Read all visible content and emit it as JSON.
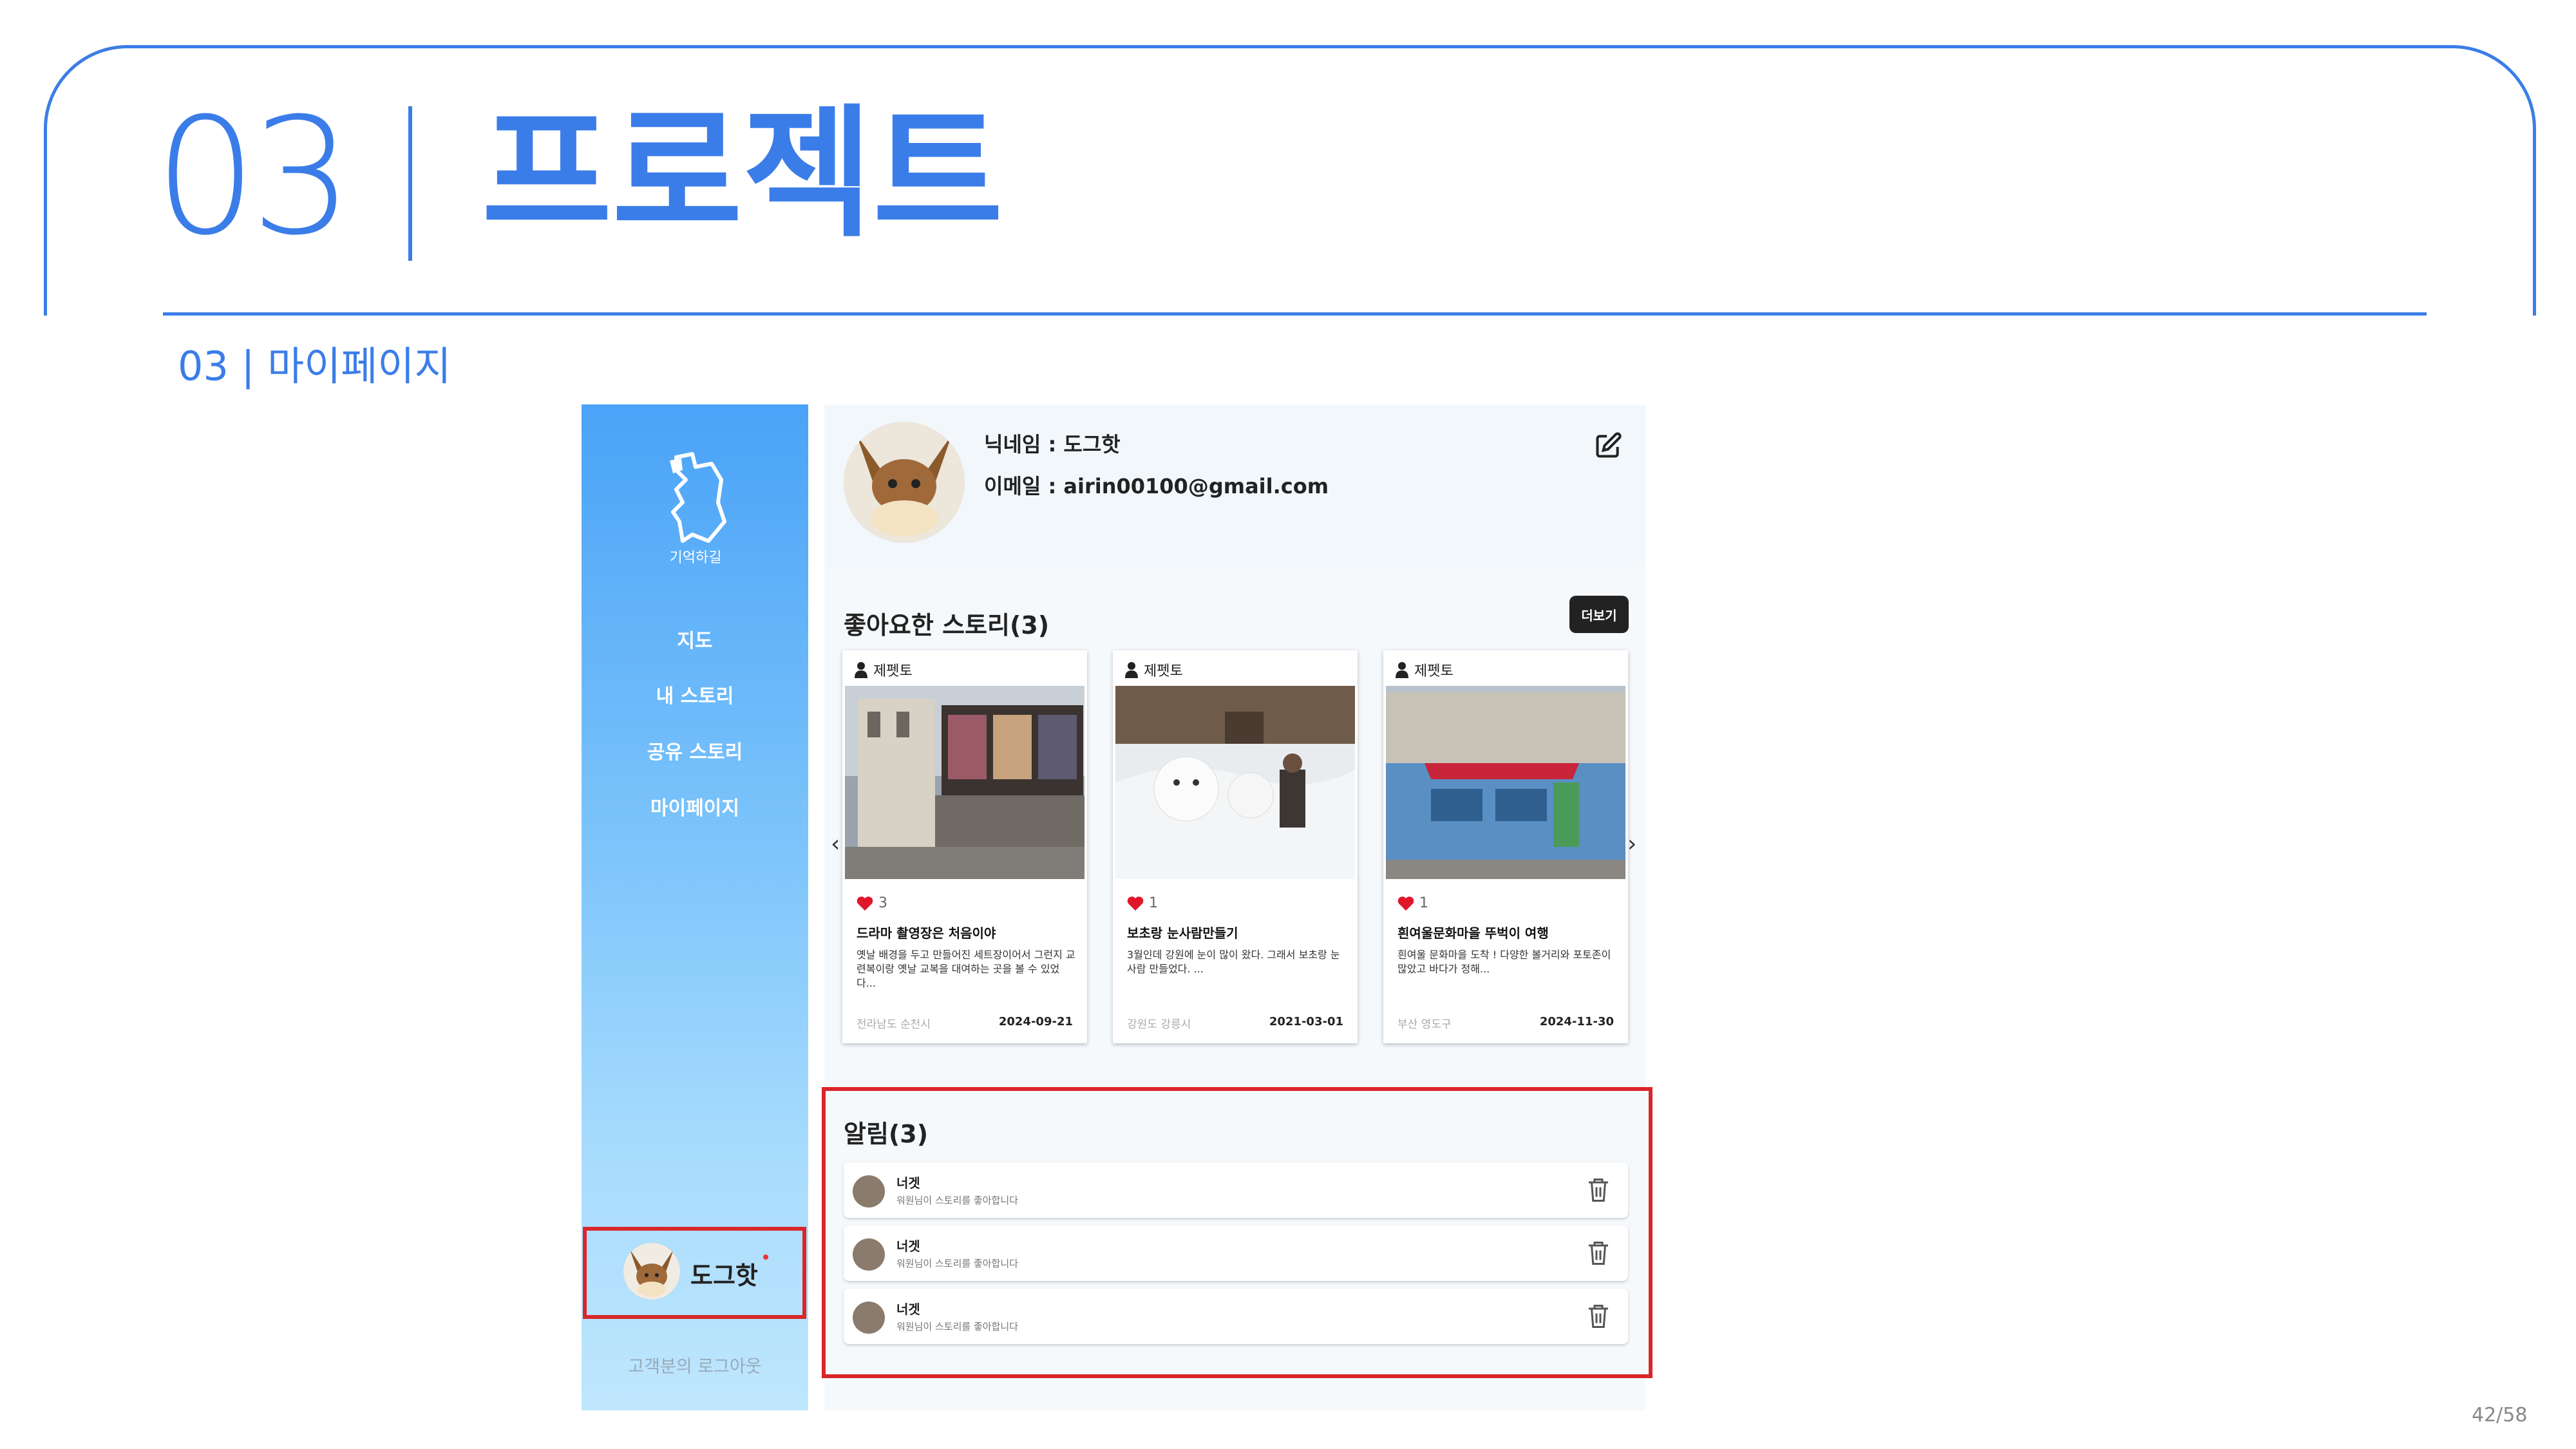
{
  "slide": {
    "number": "03",
    "title": "프로젝트",
    "subtitle": "03  |  마이페이지",
    "page_indicator": "42/58"
  },
  "sidebar": {
    "logo_text": "기억하길",
    "nav": [
      {
        "label": "지도"
      },
      {
        "label": "내 스토리"
      },
      {
        "label": "공유 스토리"
      },
      {
        "label": "마이페이지"
      }
    ],
    "user_name": "도그핫",
    "logout": "고객분의  로그아웃"
  },
  "profile": {
    "nickname_line": "닉네임 : 도그핫",
    "email_line": "이메일 : airin00100@gmail.com"
  },
  "liked": {
    "title": "좋아요한 스토리(3)",
    "more": "더보기",
    "cards": [
      {
        "author": "제펫토",
        "likes": "3",
        "title": "드라마 촬영장은 처음이야",
        "body": "옛날 배경을 두고 만들어진 세트장이어서 그런지 교련복이랑 옛날 교복을 대여하는 곳을 볼 수 있었다...",
        "location": "전라남도 순천시",
        "date": "2024-09-21"
      },
      {
        "author": "제펫토",
        "likes": "1",
        "title": "보초랑 눈사람만들기",
        "body": "3월인데 강원에 눈이 많이 왔다. 그래서 보초랑 눈사람 만들었다. ...",
        "location": "강원도 강릉시",
        "date": "2021-03-01"
      },
      {
        "author": "제펫토",
        "likes": "1",
        "title": "흰여울문화마을 뚜벅이 여행",
        "body": "흰여울 문화마을 도착 ! 다양한 볼거리와 포토존이 많았고 바다가 정해...",
        "location": "부산 영도구",
        "date": "2024-11-30"
      }
    ]
  },
  "notifications": {
    "title": "알림(3)",
    "items": [
      {
        "name": "너겟",
        "msg": "워원님이 스토리를 좋아합니다"
      },
      {
        "name": "너겟",
        "msg": "워원님이 스토리를 좋아합니다"
      },
      {
        "name": "너겟",
        "msg": "워원님이 스토리를 좋아합니다"
      }
    ]
  },
  "colors": {
    "accent": "#3b7de8",
    "highlight": "#d9262a",
    "sidebar_top": "#4aa3f7",
    "heart": "#e0162b"
  }
}
